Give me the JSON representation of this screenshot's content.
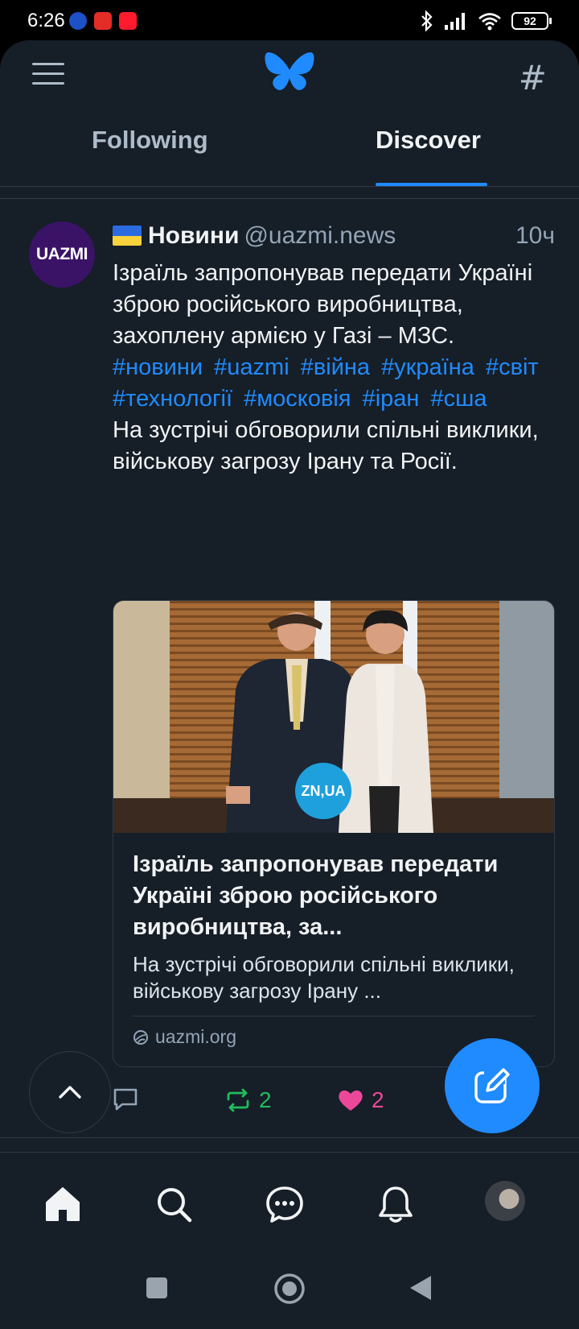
{
  "status_bar": {
    "time": "6:26",
    "battery": "92"
  },
  "tabs": {
    "following": "Following",
    "discover": "Discover"
  },
  "post": {
    "avatar_text": "UAZMI",
    "author": "Новини",
    "handle": "@uazmi.news",
    "time": "10ч",
    "text": "Ізраїль запропонував передати Україні зброю російського виробництва, захоплену армією у Газі – МЗС.",
    "hashtags": [
      "#новини",
      "#uazmi",
      "#війна",
      "#україна",
      "#світ",
      "#технології",
      "#московія",
      "#іран",
      "#сша"
    ],
    "summary": "На зустрічі обговорили спільні виклики, військову загрозу Ірану та Росії.",
    "card": {
      "image_badge": "ZN,UA",
      "title": "Ізраїль запропонував передати Україні зброю російського виробництва, за...",
      "description": "На зустрічі обговорили спільні виклики, військову загрозу Ірану ...",
      "domain": "uazmi.org"
    },
    "reply_count": "",
    "repost_count": "2",
    "like_count": "2"
  },
  "colors": {
    "background": "#161e27",
    "accent": "#208bfe",
    "repost": "#20bc5c",
    "like": "#ec4899",
    "muted": "#93a5b7"
  },
  "icons": [
    "hamburger-icon",
    "bluesky-butterfly-icon",
    "hash-icon",
    "reply-icon",
    "repost-icon",
    "heart-icon",
    "chevron-up-icon",
    "compose-icon",
    "home-icon",
    "search-icon",
    "chat-icon",
    "bell-icon",
    "link-icon"
  ]
}
